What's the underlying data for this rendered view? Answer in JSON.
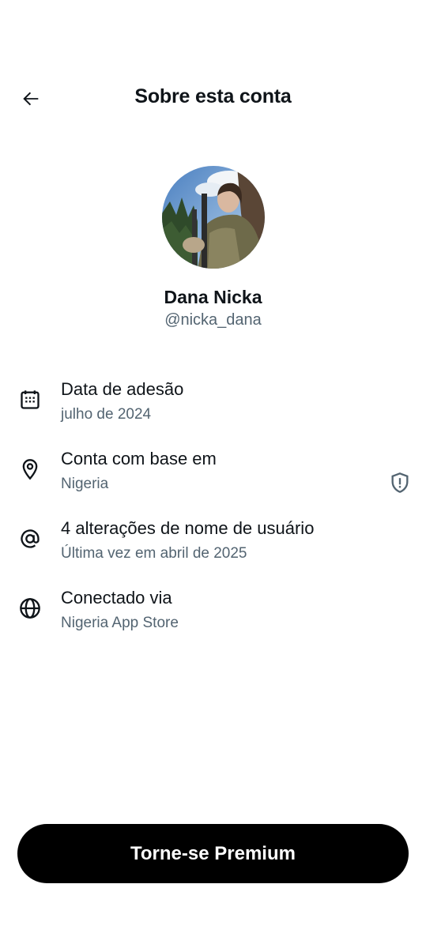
{
  "header": {
    "title": "Sobre esta conta"
  },
  "profile": {
    "name": "Dana Nicka",
    "handle": "@nicka_dana"
  },
  "info": [
    {
      "icon": "calendar-icon",
      "title": "Data de adesão",
      "value": "julho de 2024"
    },
    {
      "icon": "location-pin-icon",
      "title": "Conta com base em",
      "value": "Nigeria",
      "badge": "shield-alert-icon"
    },
    {
      "icon": "at-sign-icon",
      "title": "4 alterações de nome de usuário",
      "value": "Última vez em abril de 2025"
    },
    {
      "icon": "globe-icon",
      "title": "Conectado via",
      "value": "Nigeria App Store"
    }
  ],
  "cta": {
    "label": "Torne-se Premium"
  },
  "colors": {
    "primary_text": "#0f1419",
    "secondary_text": "#536471",
    "button_bg": "#000000",
    "button_text": "#ffffff"
  }
}
